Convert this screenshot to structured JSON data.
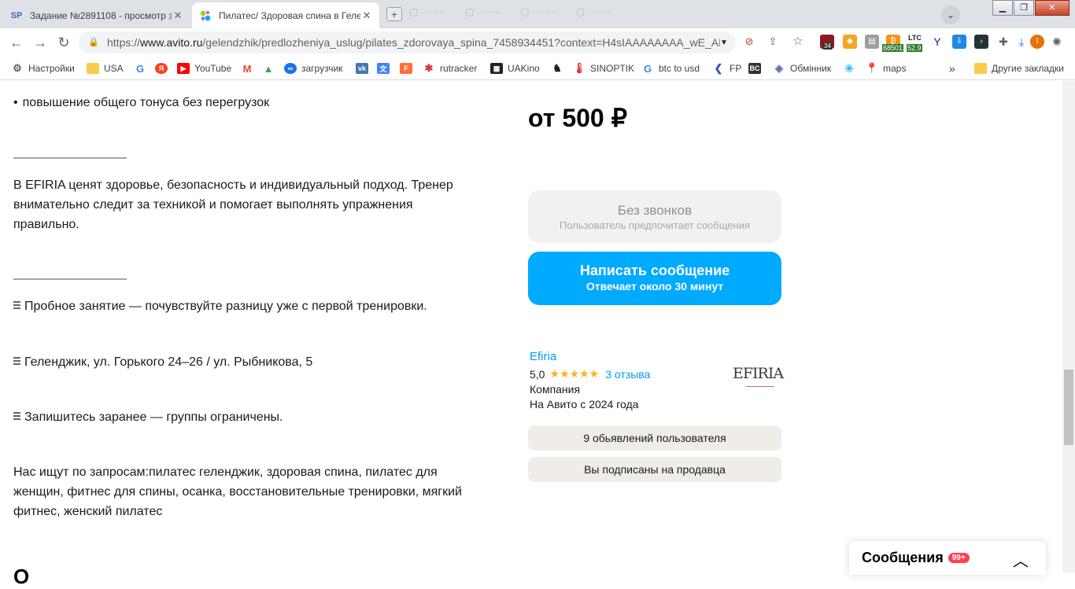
{
  "browser": {
    "tabs": [
      {
        "favicon": "SP",
        "title": "Задание №2891108 - просмотр з"
      },
      {
        "favicon": "avito",
        "title": "Пилатес/ Здоровая спина в Гелен"
      }
    ],
    "url_prefix": "https://",
    "url_host": "www.avito.ru",
    "url_path": "/gelendzhik/predlozheniya_uslug/pilates_zdorovaya_spina_7458934451?context=H4sIAAAAAAAA_wE_AM...",
    "extensions": {
      "badge1": "34",
      "btc": "68501",
      "ltc_label": "LTC",
      "ltc_value": "52.9"
    },
    "bookmarks": [
      {
        "label": "Настройки",
        "icon": "gear-icon",
        "color": "#5f6368"
      },
      {
        "label": "USA",
        "icon": "folder-icon",
        "color": "#f9cc4f"
      },
      {
        "label": "",
        "icon": "google-icon",
        "color": "#4285f4"
      },
      {
        "label": "",
        "icon": "yandex-icon",
        "color": "#fc3f1d"
      },
      {
        "label": "YouTube",
        "icon": "youtube-icon",
        "color": "#ff0000"
      },
      {
        "label": "",
        "icon": "gmail-icon",
        "color": "#ea4335"
      },
      {
        "label": "",
        "icon": "drive-icon",
        "color": "#34a853"
      },
      {
        "label": "загрузчик",
        "icon": "loop-icon",
        "color": "#1a73e8"
      },
      {
        "label": "",
        "icon": "vk-icon",
        "color": "#4a76a8"
      },
      {
        "label": "",
        "icon": "translate-icon",
        "color": "#4285f4"
      },
      {
        "label": "",
        "icon": "f-icon",
        "color": "#ff6d3b"
      },
      {
        "label": "rutracker",
        "icon": "rutracker-icon",
        "color": "#d23a3a"
      },
      {
        "label": "UAKino",
        "icon": "uakino-icon",
        "color": "#222222"
      },
      {
        "label": "",
        "icon": "person-icon",
        "color": "#222222"
      },
      {
        "label": "SINOPTIK",
        "icon": "thermometer-icon",
        "color": "#d32f2f"
      },
      {
        "label": "btc to usd",
        "icon": "google-icon",
        "color": "#4285f4"
      },
      {
        "label": "FP",
        "icon": "fp-icon",
        "color": "#3f51b5"
      },
      {
        "label": "",
        "icon": "bc-icon",
        "color": "#333333"
      },
      {
        "label": "Обмінник",
        "icon": "exchange-icon",
        "color": "#5c6bc0"
      },
      {
        "label": "",
        "icon": "star-icon",
        "color": "#29b6f6"
      },
      {
        "label": "maps",
        "icon": "maps-icon",
        "color": "#34a853"
      }
    ],
    "other_bookmarks": "Другие закладки",
    "more": "»"
  },
  "listing": {
    "desc": [
      {
        "bullet": "•",
        "text": "повышение общего тонуса без перегрузок"
      },
      {
        "text": "—————————"
      },
      {
        "text": "В EFIRIA ценят здоровье, безопасность и индивидуальный подход. Тренер внимательно следит за техникой и помогает выполнять упражнения правильно."
      },
      {
        "text": "—————————"
      },
      {
        "text": "Пробное занятие — почувствуйте разницу уже с первой тренировки."
      },
      {
        "text": "Геленджик, ул. Горького 24–26 / ул. Рыбникова, 5"
      },
      {
        "text": "Запишитесь заранее — группы ограничены."
      },
      {
        "text": "Нас ищут по запросам:пилатес геленджик, здоровая спина, пилатес для женщин, фитнес для спины, осанка, восстановительные тренировки, мягкий фитнес, женский пилатес"
      }
    ],
    "next_heading_partial": "О"
  },
  "sidebar": {
    "price": "от 500 ₽",
    "no_calls": {
      "title": "Без звонков",
      "subtitle": "Пользователь предпочитает сообщения"
    },
    "write_message": {
      "title": "Написать сообщение",
      "subtitle": "Отвечает около 30 минут"
    },
    "seller": {
      "name": "Efiria",
      "rating": "5,0",
      "stars": "★★★★★",
      "reviews": "3 отзыва",
      "type": "Компания",
      "since": "На Авито с 2024 года",
      "logo_text": "EFIRIA"
    },
    "ads_count_button": "9 обьявлений пользователя",
    "subscribed_button": "Вы подписаны на продавца"
  },
  "messenger": {
    "label": "Сообщения",
    "badge": "99+"
  },
  "colors": {
    "accent": "#00aaff",
    "link": "#0099f7",
    "star": "#ffb021",
    "badge": "#ff4053"
  }
}
